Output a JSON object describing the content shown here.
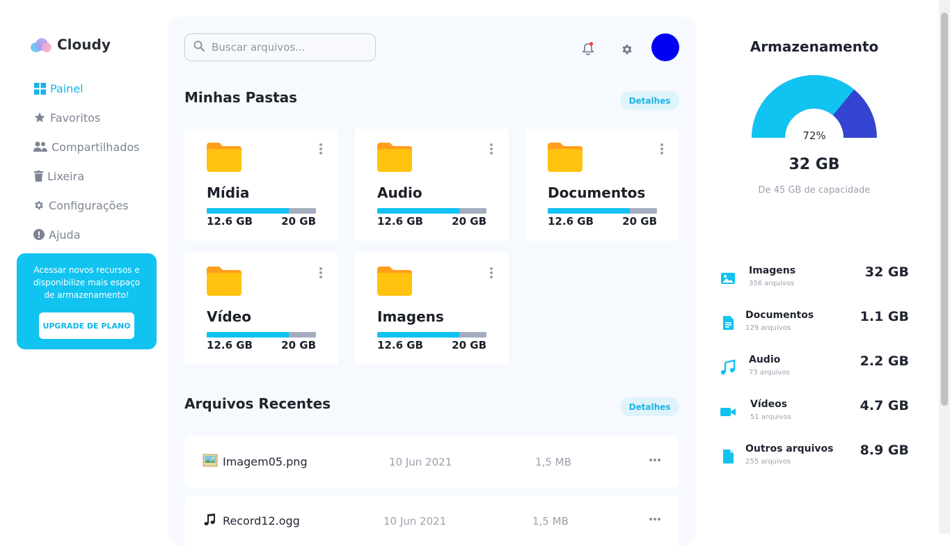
{
  "app": {
    "name": "Cloudy"
  },
  "sidebar": {
    "items": [
      {
        "label": "Painel",
        "icon": "grid-icon"
      },
      {
        "label": "Favoritos",
        "icon": "star-icon"
      },
      {
        "label": "Compartilhados",
        "icon": "users-icon"
      },
      {
        "label": "Lixeira",
        "icon": "trash-icon"
      },
      {
        "label": "Configurações",
        "icon": "gear-icon"
      },
      {
        "label": "Ajuda",
        "icon": "help-icon"
      }
    ],
    "promo": {
      "text": "Acessar novos recursos e disponibilize mais espaço de armazenamento!",
      "button": "UPGRADE DE PLANO"
    }
  },
  "header": {
    "search_placeholder": "Buscar arquivos..."
  },
  "folders": {
    "title": "Minhas Pastas",
    "details": "Detalhes",
    "items": [
      {
        "name": "Mídia",
        "used": "12.6 GB",
        "total": "20 GB",
        "fraction": 0.75
      },
      {
        "name": "Audio",
        "used": "12.6 GB",
        "total": "20 GB",
        "fraction": 0.75
      },
      {
        "name": "Documentos",
        "used": "12.6 GB",
        "total": "20 GB",
        "fraction": 0.75
      },
      {
        "name": "Vídeo",
        "used": "12.6 GB",
        "total": "20 GB",
        "fraction": 0.75
      },
      {
        "name": "Imagens",
        "used": "12.6 GB",
        "total": "20 GB",
        "fraction": 0.75
      }
    ]
  },
  "recent": {
    "title": "Arquivos Recentes",
    "details": "Detalhes",
    "files": [
      {
        "name": "Imagem05.png",
        "date": "10 Jun 2021",
        "size": "1,5 MB",
        "icon": "image-file-icon"
      },
      {
        "name": "Record12.ogg",
        "date": "10 Jun 2021",
        "size": "1,5 MB",
        "icon": "music-note-icon"
      }
    ]
  },
  "storage": {
    "title": "Armazenamento",
    "percent_label": "72%",
    "percent": 72,
    "used": "32 GB",
    "capacity": "De 45 GB de capacidade",
    "categories": [
      {
        "name": "Imagens",
        "count": "356 arquivos",
        "size": "32 GB",
        "icon": "image-icon"
      },
      {
        "name": "Documentos",
        "count": "129 arquivos",
        "size": "1.1 GB",
        "icon": "document-icon"
      },
      {
        "name": "Audio",
        "count": "73 arquivos",
        "size": "2.2 GB",
        "icon": "music-icon"
      },
      {
        "name": "Vídeos",
        "count": "51 arquivos",
        "size": "4.7 GB",
        "icon": "video-icon"
      },
      {
        "name": "Outros arquivos",
        "count": "255 arquivos",
        "size": "8.9 GB",
        "icon": "file-icon"
      }
    ]
  },
  "colors": {
    "accent": "#11c3f0",
    "gauge_secondary": "#3244d0",
    "folder": "#ffc20e",
    "avatar": "#0000f5"
  }
}
